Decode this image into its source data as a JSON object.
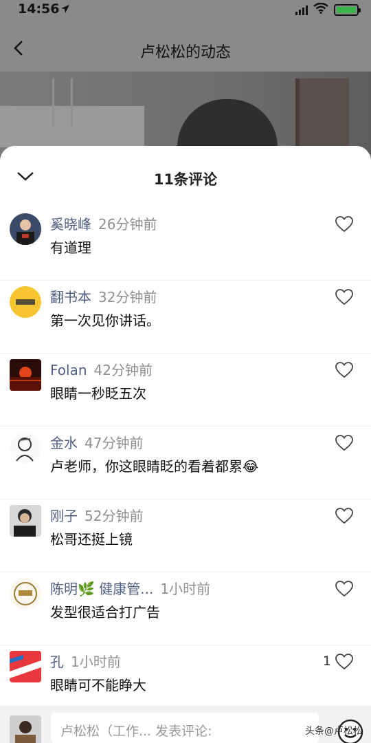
{
  "status_bar": {
    "time": "14:56"
  },
  "nav": {
    "title": "卢松松的动态"
  },
  "sheet": {
    "comment_count_label": "11条评论"
  },
  "comments": [
    {
      "username": "奚晓峰",
      "time": "26分钟前",
      "text": "有道理",
      "likes": ""
    },
    {
      "username": "翻书本",
      "time": "32分钟前",
      "text": "第一次见你讲话。",
      "likes": ""
    },
    {
      "username": "Folan",
      "time": "42分钟前",
      "text": "眼睛一秒眨五次",
      "likes": ""
    },
    {
      "username": "金水",
      "time": "47分钟前",
      "text": "卢老师，你这眼睛眨的看着都累😂",
      "likes": ""
    },
    {
      "username": "刚子",
      "time": "52分钟前",
      "text": "松哥还挺上镜",
      "likes": ""
    },
    {
      "username": "陈明🌿 健康管...",
      "time": "1小时前",
      "text": "发型很适合打广告",
      "likes": ""
    },
    {
      "username": "孔",
      "time": "1小时前",
      "text": "眼睛可不能睁大",
      "likes": "1"
    }
  ],
  "input": {
    "placeholder": "卢松松（工作... 发表评论:"
  },
  "watermark": "头条@卢松松"
}
